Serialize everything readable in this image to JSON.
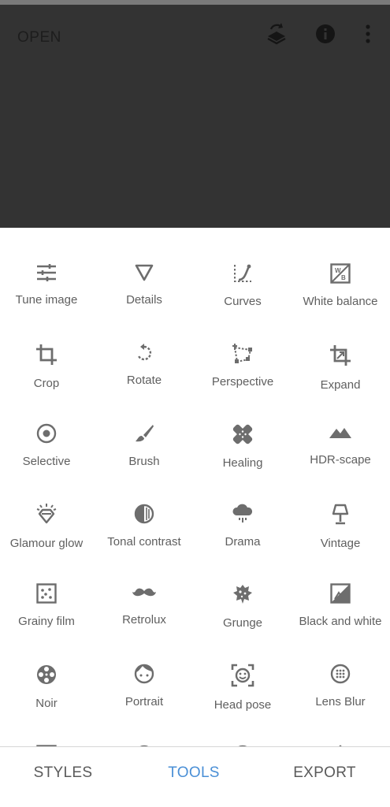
{
  "colors": {
    "accent": "#4a8fd6",
    "icon": "#6d6d6d",
    "label": "#5f5f5f",
    "image_bg": "#333333"
  },
  "header": {
    "open_label": "OPEN",
    "icons": [
      "layers-undo-icon",
      "info-icon",
      "more-vert-icon"
    ]
  },
  "tools": [
    {
      "label": "Tune image",
      "icon": "tune-icon"
    },
    {
      "label": "Details",
      "icon": "details-triangle-icon"
    },
    {
      "label": "Curves",
      "icon": "curves-icon"
    },
    {
      "label": "White balance",
      "icon": "white-balance-icon"
    },
    {
      "label": "Crop",
      "icon": "crop-icon"
    },
    {
      "label": "Rotate",
      "icon": "rotate-icon"
    },
    {
      "label": "Perspective",
      "icon": "perspective-icon"
    },
    {
      "label": "Expand",
      "icon": "expand-icon"
    },
    {
      "label": "Selective",
      "icon": "selective-icon"
    },
    {
      "label": "Brush",
      "icon": "brush-icon"
    },
    {
      "label": "Healing",
      "icon": "healing-icon"
    },
    {
      "label": "HDR-scape",
      "icon": "mountains-icon"
    },
    {
      "label": "Glamour glow",
      "icon": "glamour-glow-icon"
    },
    {
      "label": "Tonal contrast",
      "icon": "tonal-contrast-icon"
    },
    {
      "label": "Drama",
      "icon": "drama-cloud-icon"
    },
    {
      "label": "Vintage",
      "icon": "vintage-lamp-icon"
    },
    {
      "label": "Grainy film",
      "icon": "grainy-film-icon"
    },
    {
      "label": "Retrolux",
      "icon": "mustache-icon"
    },
    {
      "label": "Grunge",
      "icon": "grunge-icon"
    },
    {
      "label": "Black and white",
      "icon": "black-white-icon"
    },
    {
      "label": "Noir",
      "icon": "film-reel-icon"
    },
    {
      "label": "Portrait",
      "icon": "portrait-face-icon"
    },
    {
      "label": "Head pose",
      "icon": "head-pose-icon"
    },
    {
      "label": "Lens Blur",
      "icon": "lens-blur-icon"
    },
    {
      "label": "",
      "icon": "frame-icon"
    },
    {
      "label": "",
      "icon": "text-icon"
    },
    {
      "label": "",
      "icon": "face-icon"
    },
    {
      "label": "",
      "icon": "double-exposure-icon"
    }
  ],
  "bottom_tabs": [
    {
      "label": "STYLES",
      "active": false
    },
    {
      "label": "TOOLS",
      "active": true
    },
    {
      "label": "EXPORT",
      "active": false
    }
  ]
}
